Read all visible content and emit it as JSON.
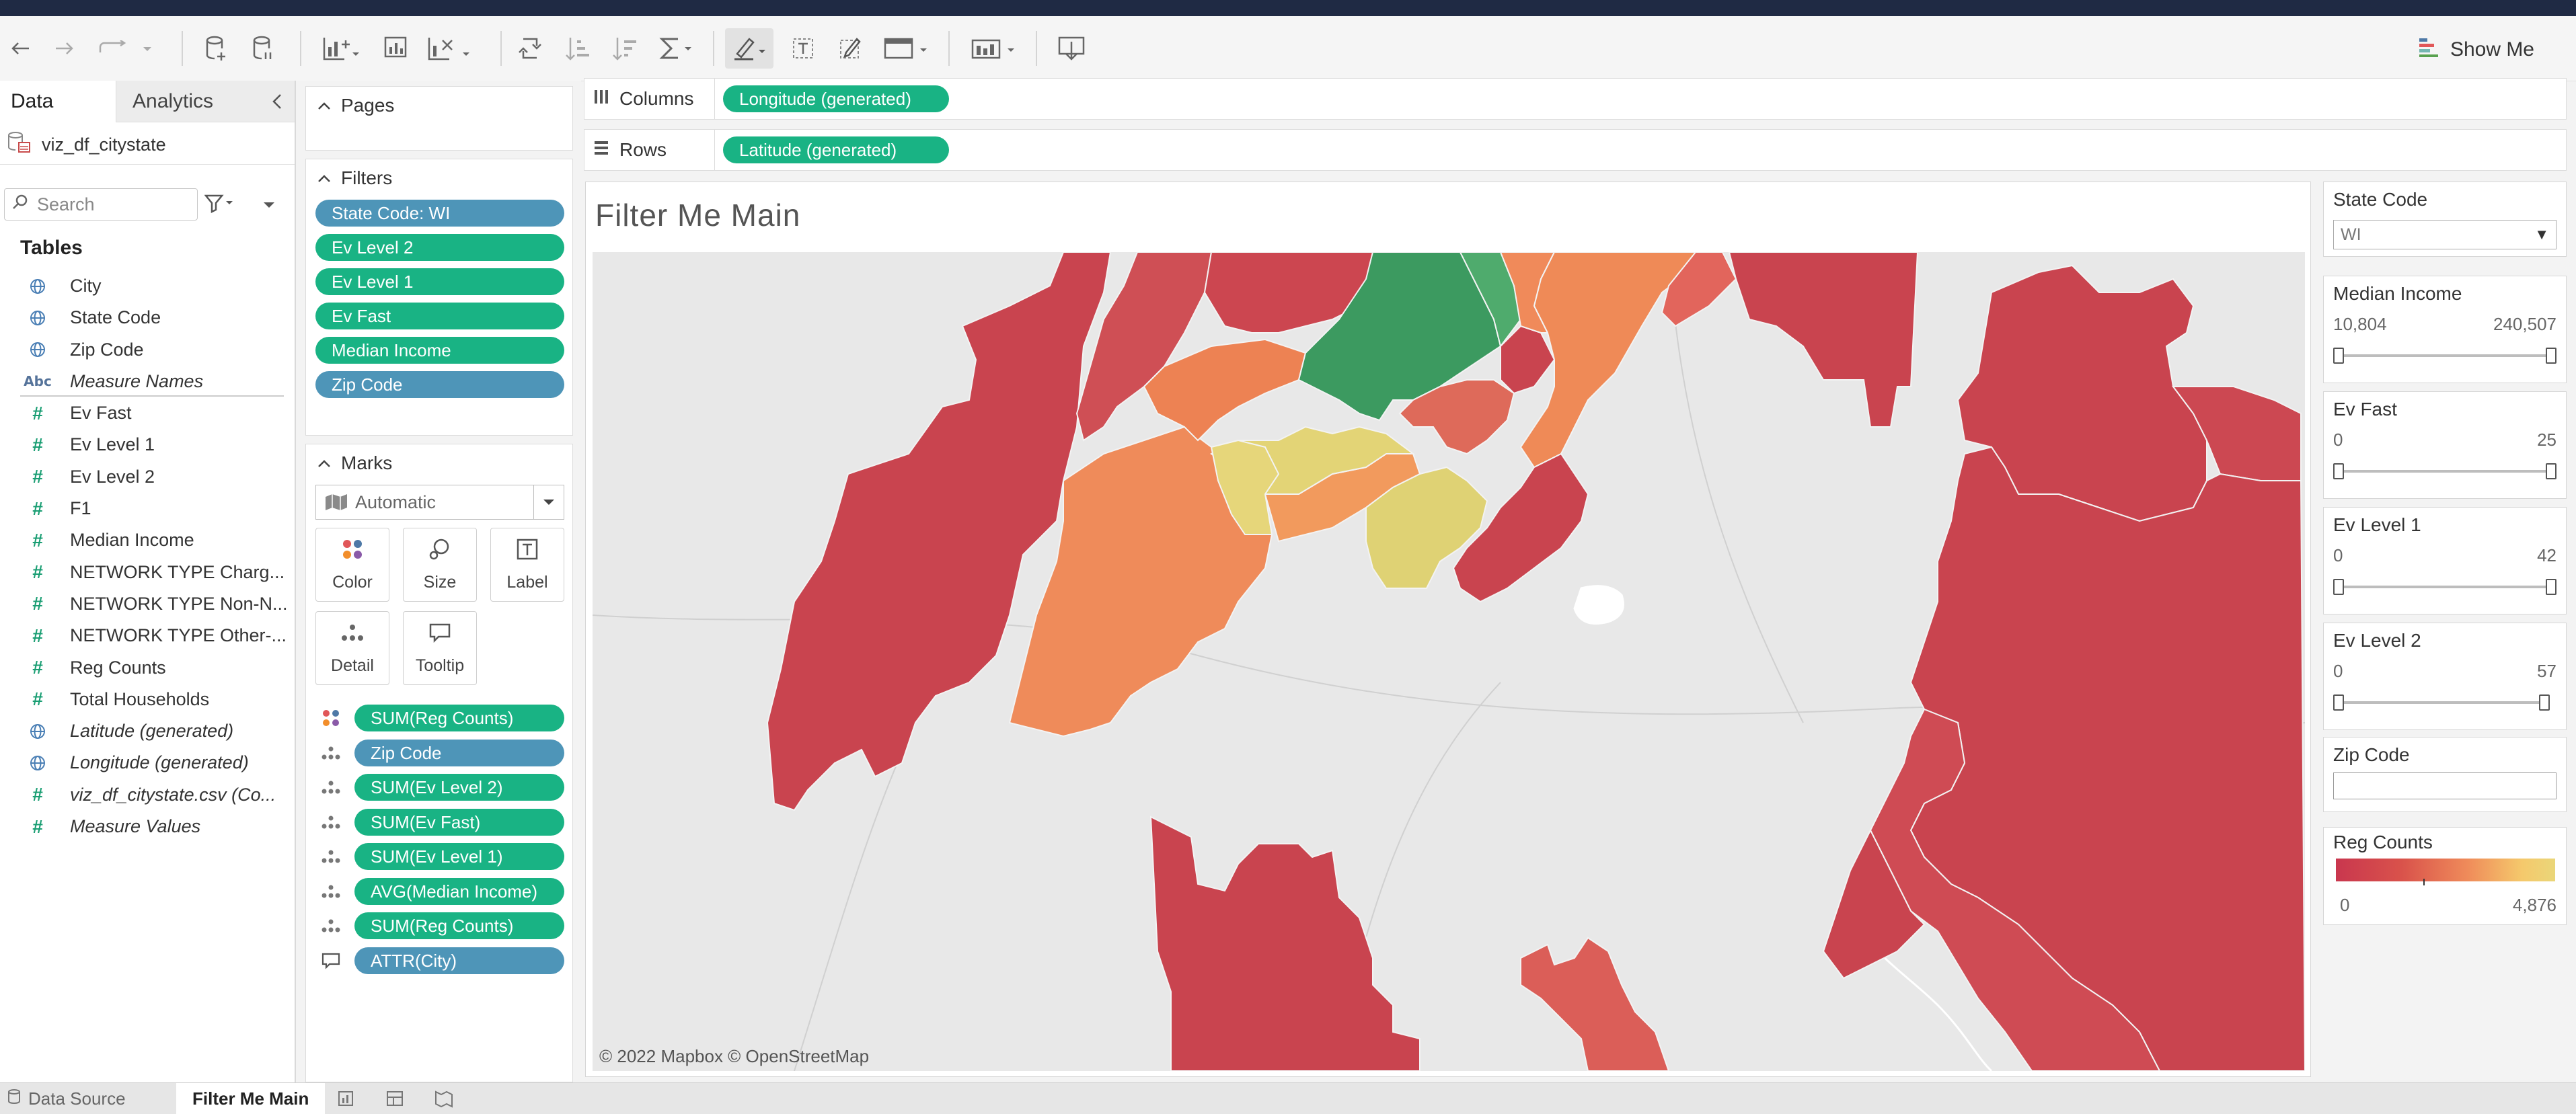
{
  "toolbar": {
    "show_me": "Show Me"
  },
  "data_pane": {
    "tabs": {
      "data": "Data",
      "analytics": "Analytics"
    },
    "datasource": "viz_df_citystate",
    "search_placeholder": "Search",
    "tables_heading": "Tables",
    "fields": [
      {
        "label": "City",
        "type": "geo",
        "italic": false
      },
      {
        "label": "State Code",
        "type": "geo",
        "italic": false
      },
      {
        "label": "Zip Code",
        "type": "geo",
        "italic": false
      },
      {
        "label": "Measure Names",
        "type": "abc",
        "italic": true
      },
      {
        "label": "Ev Fast",
        "type": "num",
        "italic": false
      },
      {
        "label": "Ev Level 1",
        "type": "num",
        "italic": false
      },
      {
        "label": "Ev Level 2",
        "type": "num",
        "italic": false
      },
      {
        "label": "F1",
        "type": "num",
        "italic": false
      },
      {
        "label": "Median Income",
        "type": "num",
        "italic": false
      },
      {
        "label": "NETWORK TYPE Charg...",
        "type": "num",
        "italic": false
      },
      {
        "label": "NETWORK TYPE Non-N...",
        "type": "num",
        "italic": false
      },
      {
        "label": "NETWORK TYPE Other-...",
        "type": "num",
        "italic": false
      },
      {
        "label": "Reg Counts",
        "type": "num",
        "italic": false
      },
      {
        "label": "Total Households",
        "type": "num",
        "italic": false
      },
      {
        "label": "Latitude (generated)",
        "type": "geo",
        "italic": true
      },
      {
        "label": "Longitude (generated)",
        "type": "geo",
        "italic": true
      },
      {
        "label": "viz_df_citystate.csv (Co...",
        "type": "num",
        "italic": true
      },
      {
        "label": "Measure Values",
        "type": "num",
        "italic": true
      }
    ]
  },
  "pages": {
    "title": "Pages"
  },
  "filters": {
    "title": "Filters",
    "pills": [
      {
        "label": "State Code: WI",
        "color": "blue"
      },
      {
        "label": "Ev Level 2",
        "color": "green"
      },
      {
        "label": "Ev Level 1",
        "color": "green"
      },
      {
        "label": "Ev Fast",
        "color": "green"
      },
      {
        "label": "Median Income",
        "color": "green"
      },
      {
        "label": "Zip Code",
        "color": "blue"
      }
    ]
  },
  "marks": {
    "title": "Marks",
    "mark_type": "Automatic",
    "buttons": {
      "color": "Color",
      "size": "Size",
      "label": "Label",
      "detail": "Detail",
      "tooltip": "Tooltip"
    },
    "fields": [
      {
        "icon": "color",
        "label": "SUM(Reg Counts)",
        "color": "green"
      },
      {
        "icon": "detail",
        "label": "Zip Code",
        "color": "blue"
      },
      {
        "icon": "detail",
        "label": "SUM(Ev Level 2)",
        "color": "green"
      },
      {
        "icon": "detail",
        "label": "SUM(Ev Fast)",
        "color": "green"
      },
      {
        "icon": "detail",
        "label": "SUM(Ev Level 1)",
        "color": "green"
      },
      {
        "icon": "detail",
        "label": "AVG(Median Income)",
        "color": "green"
      },
      {
        "icon": "detail",
        "label": "SUM(Reg Counts)",
        "color": "green"
      },
      {
        "icon": "tooltip",
        "label": "ATTR(City)",
        "color": "blue"
      }
    ]
  },
  "columns_shelf": {
    "label": "Columns",
    "pill": "Longitude (generated)"
  },
  "rows_shelf": {
    "label": "Rows",
    "pill": "Latitude (generated)"
  },
  "viz": {
    "title": "Filter Me Main",
    "attribution": "© 2022 Mapbox  © OpenStreetMap"
  },
  "right_panel": {
    "state_code": {
      "title": "State Code",
      "value": "WI"
    },
    "median_income": {
      "title": "Median Income",
      "min": "10,804",
      "max": "240,507"
    },
    "ev_fast": {
      "title": "Ev Fast",
      "min": "0",
      "max": "25"
    },
    "ev_level_1": {
      "title": "Ev Level 1",
      "min": "0",
      "max": "42"
    },
    "ev_level_2": {
      "title": "Ev Level 2",
      "min": "0",
      "max": "57"
    },
    "zip_code": {
      "title": "Zip Code",
      "value": ""
    },
    "reg_counts": {
      "title": "Reg Counts",
      "min": "0",
      "max": "4,876"
    }
  },
  "bottom_tabs": {
    "data_source": "Data Source",
    "sheet": "Filter Me Main"
  },
  "colors": {
    "green_pill": "#19b384",
    "blue_pill": "#4e95b8",
    "map_red": "#c9444f",
    "map_orange": "#ef8b5a",
    "map_yellow": "#dfd274",
    "map_green": "#3c9a60"
  }
}
